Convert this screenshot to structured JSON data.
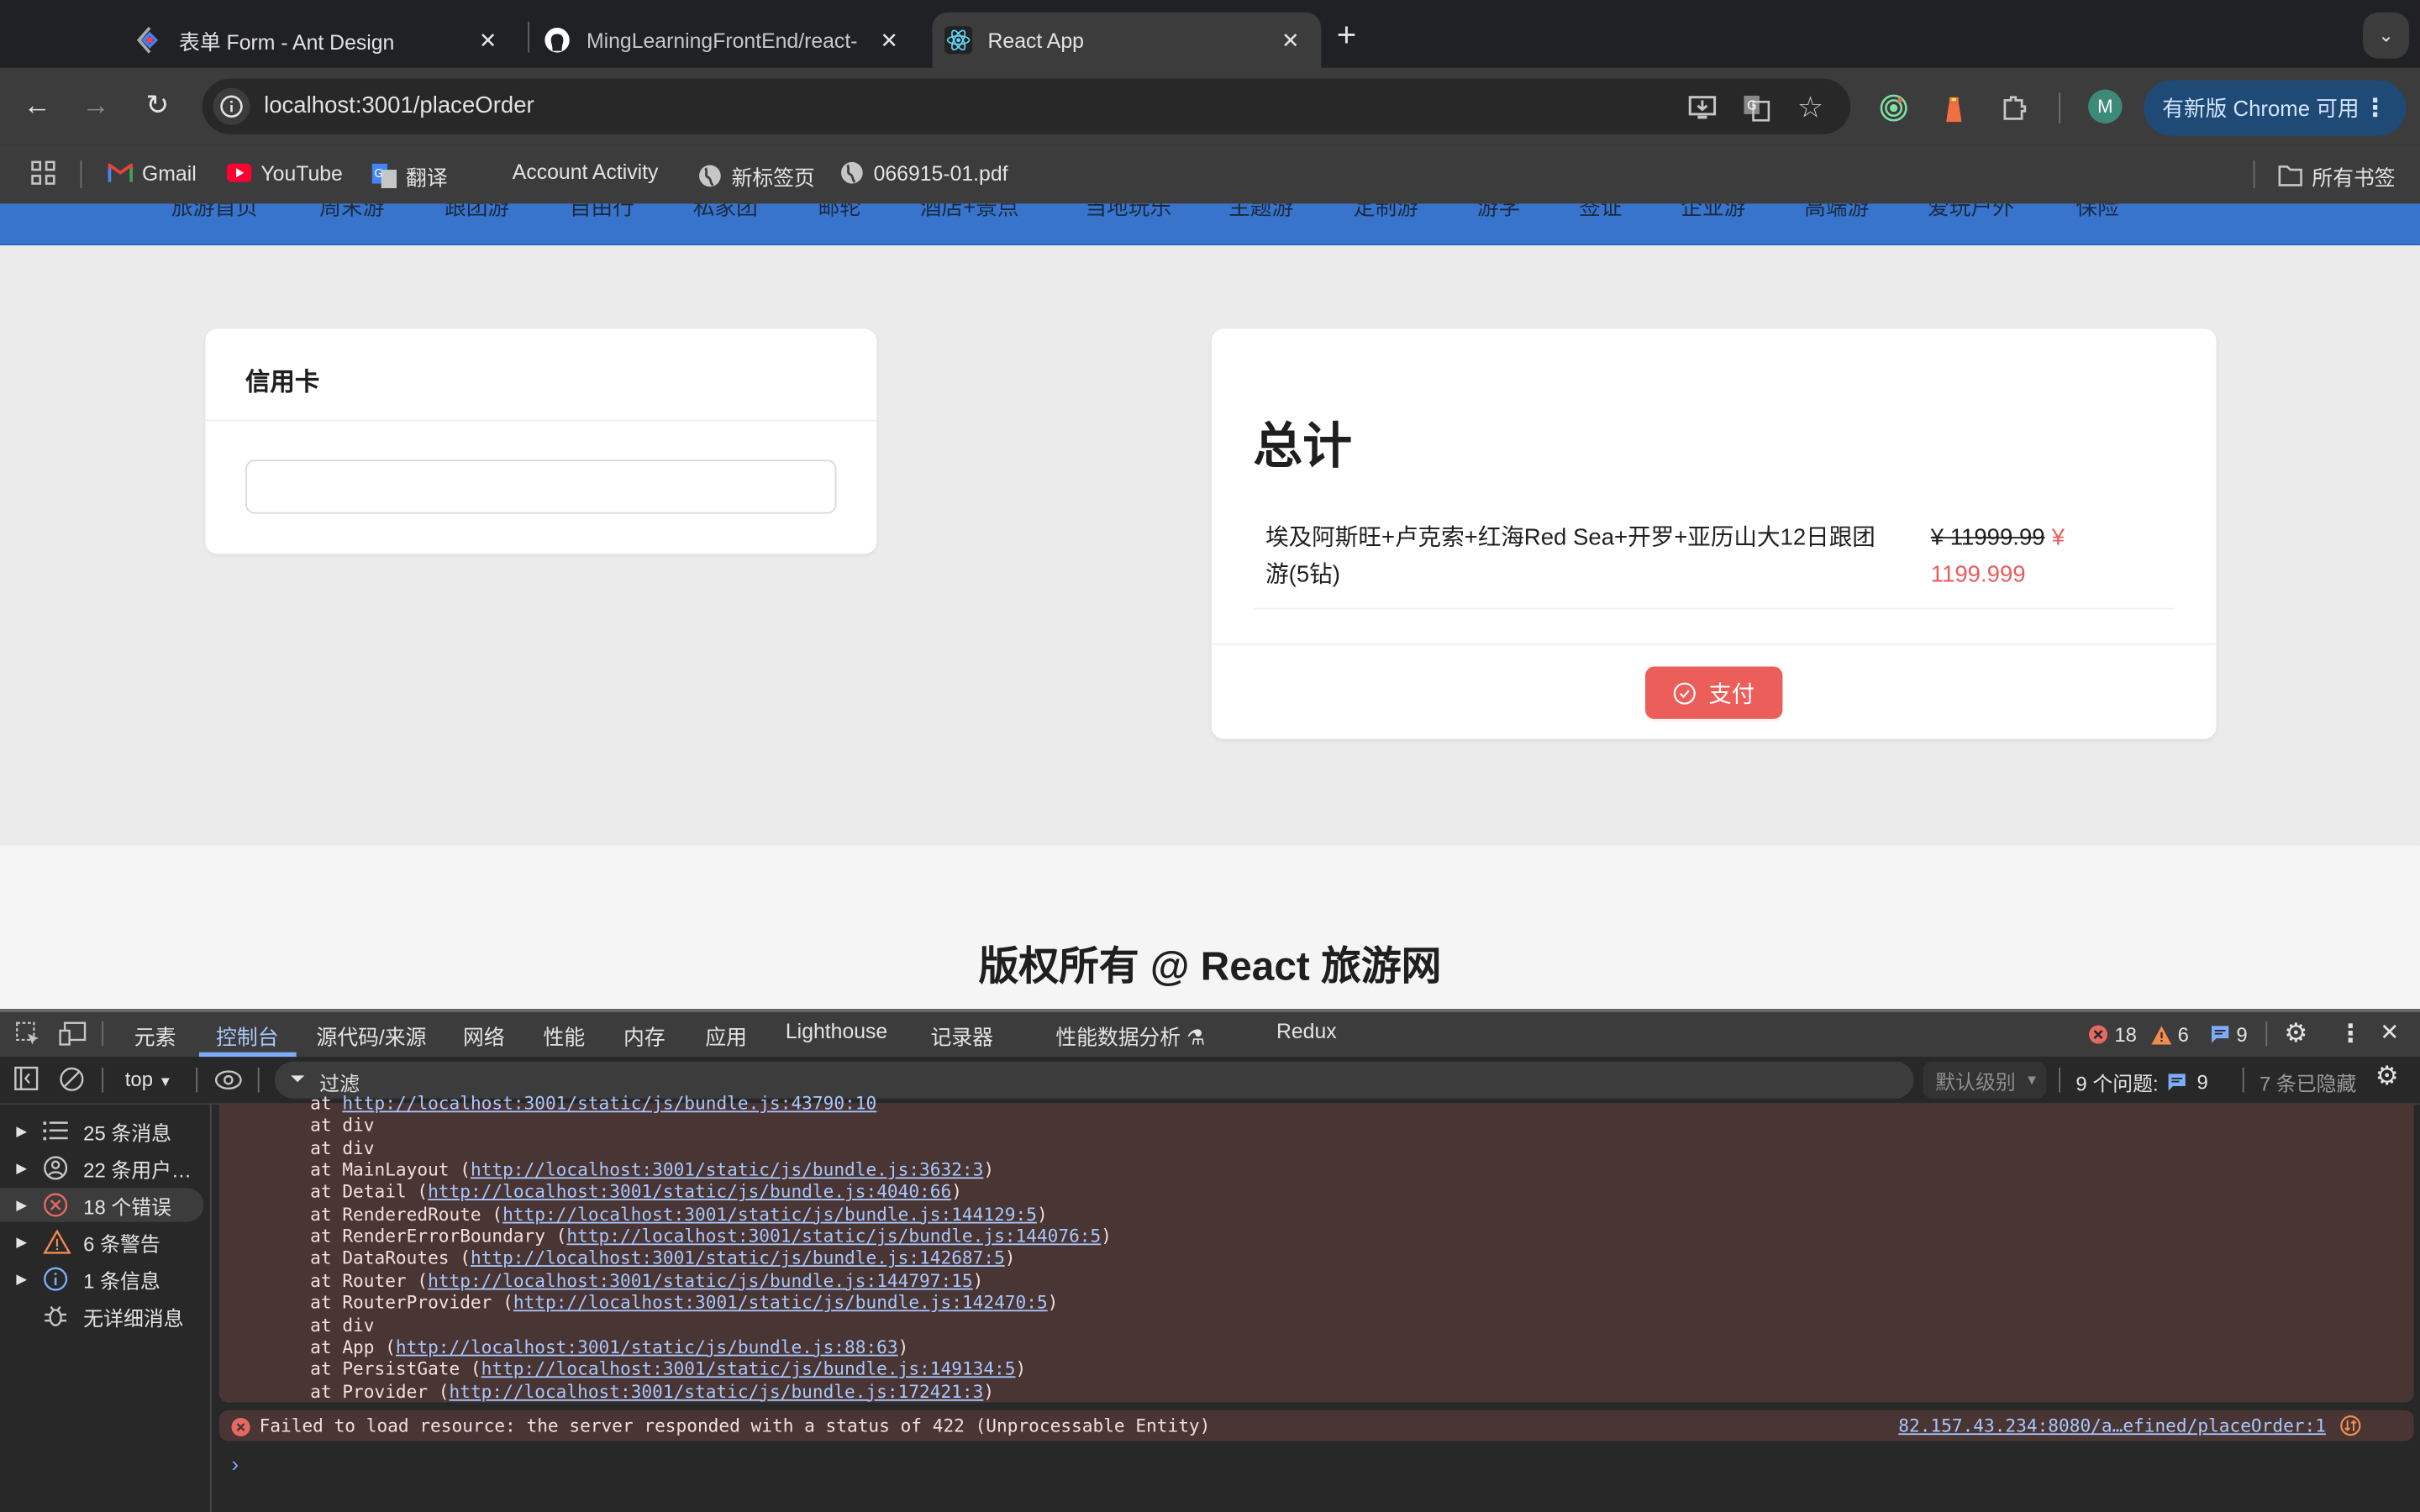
{
  "browser": {
    "tabs": [
      {
        "title": "表单 Form - Ant Design",
        "icon": "ant-design-icon",
        "active": false
      },
      {
        "title": "MingLearningFrontEnd/react-",
        "icon": "github-icon",
        "active": false
      },
      {
        "title": "React App",
        "icon": "react-icon",
        "active": true
      }
    ],
    "new_tab_symbol": "+",
    "tab_list_symbol": "⌄",
    "url": "localhost:3001/placeOrder",
    "avatar_letter": "M",
    "update_button": "有新版 Chrome 可用",
    "bookmarks": [
      {
        "label": "Gmail",
        "icon": "gmail-icon"
      },
      {
        "label": "YouTube",
        "icon": "youtube-icon"
      },
      {
        "label": "翻译",
        "icon": "google-translate-icon"
      },
      {
        "label": "Account Activity",
        "icon": ""
      },
      {
        "label": "新标签页",
        "icon": "globe-icon"
      },
      {
        "label": "066915-01.pdf",
        "icon": "globe-icon"
      }
    ],
    "all_bookmarks": "所有书签"
  },
  "page": {
    "nav_items": [
      "旅游首页",
      "周末游",
      "跟团游",
      "自由行",
      "私家团",
      "邮轮",
      "酒店+景点",
      "当地玩乐",
      "主题游",
      "定制游",
      "游学",
      "签证",
      "企业游",
      "高端游",
      "爱玩户外",
      "保险"
    ],
    "credit_card": {
      "title": "信用卡",
      "input_value": ""
    },
    "order": {
      "title": "总计",
      "items": [
        {
          "name": "埃及阿斯旺+卢克索+红海Red Sea+开罗+亚历山大12日跟团游(5钻)",
          "original_price": "¥ 11999.99",
          "discount_price": "¥ 1199.999"
        }
      ],
      "pay_button": "支付"
    },
    "footer": "版权所有 @ React 旅游网"
  },
  "devtools": {
    "tabs": [
      "元素",
      "控制台",
      "源代码/来源",
      "网络",
      "性能",
      "内存",
      "应用",
      "Lighthouse",
      "记录器",
      "性能数据分析 ⚗",
      "Redux"
    ],
    "active_tab": "控制台",
    "counts": {
      "errors": "18",
      "warnings": "6",
      "issues": "9"
    },
    "context": "top",
    "filter_placeholder": "过滤",
    "level": "默认级别",
    "issues_label": "9 个问题:",
    "issues_count": "9",
    "hidden_label": "7 条已隐藏",
    "sidebar": [
      {
        "label": "25 条消息",
        "icon": "list-icon"
      },
      {
        "label": "22 条用户…",
        "icon": "user-icon"
      },
      {
        "label": "18 个错误",
        "icon": "error-icon",
        "selected": true
      },
      {
        "label": "6 条警告",
        "icon": "warning-icon"
      },
      {
        "label": "1 条信息",
        "icon": "info-icon"
      },
      {
        "label": "无详细消息",
        "icon": "bug-icon"
      }
    ],
    "stack": [
      {
        "prefix": "at ",
        "link": "http://localhost:3001/static/js/bundle.js:43790:10",
        "suffix": ""
      },
      {
        "prefix": "at div",
        "link": "",
        "suffix": ""
      },
      {
        "prefix": "at div",
        "link": "",
        "suffix": ""
      },
      {
        "prefix": "at MainLayout (",
        "link": "http://localhost:3001/static/js/bundle.js:3632:3",
        "suffix": ")"
      },
      {
        "prefix": "at Detail (",
        "link": "http://localhost:3001/static/js/bundle.js:4040:66",
        "suffix": ")"
      },
      {
        "prefix": "at RenderedRoute (",
        "link": "http://localhost:3001/static/js/bundle.js:144129:5",
        "suffix": ")"
      },
      {
        "prefix": "at RenderErrorBoundary (",
        "link": "http://localhost:3001/static/js/bundle.js:144076:5",
        "suffix": ")"
      },
      {
        "prefix": "at DataRoutes (",
        "link": "http://localhost:3001/static/js/bundle.js:142687:5",
        "suffix": ")"
      },
      {
        "prefix": "at Router (",
        "link": "http://localhost:3001/static/js/bundle.js:144797:15",
        "suffix": ")"
      },
      {
        "prefix": "at RouterProvider (",
        "link": "http://localhost:3001/static/js/bundle.js:142470:5",
        "suffix": ")"
      },
      {
        "prefix": "at div",
        "link": "",
        "suffix": ""
      },
      {
        "prefix": "at App (",
        "link": "http://localhost:3001/static/js/bundle.js:88:63",
        "suffix": ")"
      },
      {
        "prefix": "at PersistGate (",
        "link": "http://localhost:3001/static/js/bundle.js:149134:5",
        "suffix": ")"
      },
      {
        "prefix": "at Provider (",
        "link": "http://localhost:3001/static/js/bundle.js:172421:3",
        "suffix": ")"
      }
    ],
    "error_message": "Failed to load resource: the server responded with a status of 422 (Unprocessable Entity)",
    "error_source": "82.157.43.234:8080/a…efined/placeOrder:1",
    "prompt": "›"
  },
  "colors": {
    "nav_blue": "#3874cc",
    "pay_red": "#ec5e5a",
    "price_red": "#e85c5c",
    "devtools_accent": "#a8c7fa",
    "error_bg": "#4a3535"
  }
}
